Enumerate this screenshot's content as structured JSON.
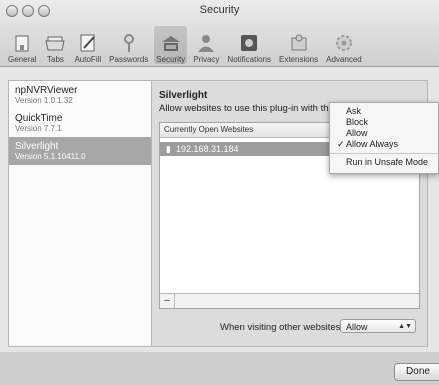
{
  "window": {
    "title": "Security"
  },
  "toolbar": {
    "items": [
      {
        "label": "General",
        "icon": "general-icon"
      },
      {
        "label": "Tabs",
        "icon": "tabs-icon"
      },
      {
        "label": "AutoFill",
        "icon": "autofill-icon"
      },
      {
        "label": "Passwords",
        "icon": "key-icon"
      },
      {
        "label": "Security",
        "icon": "lock-icon",
        "active": true
      },
      {
        "label": "Privacy",
        "icon": "person-icon"
      },
      {
        "label": "Notifications",
        "icon": "notifications-icon"
      },
      {
        "label": "Extensions",
        "icon": "puzzle-icon"
      },
      {
        "label": "Advanced",
        "icon": "gear-icon"
      }
    ]
  },
  "plugins": [
    {
      "name": "npNVRViewer",
      "version": "Version 1.0.1.32"
    },
    {
      "name": "QuickTime",
      "version": "Version 7.7.1"
    },
    {
      "name": "Silverlight",
      "version": "Version 5.1.10411.0",
      "selected": true
    }
  ],
  "main": {
    "title": "Silverlight",
    "description": "Allow websites to use this plug-in with th",
    "sites_header": "Currently Open Websites",
    "sites": [
      {
        "host": "192.168.31.184"
      }
    ],
    "minus_label": "–",
    "other_label": "When visiting other websites:",
    "other_value": "Allow",
    "other_arrows": "▲▼"
  },
  "menu": {
    "items": [
      {
        "label": "Ask",
        "checked": false
      },
      {
        "label": "Block",
        "checked": false
      },
      {
        "label": "Allow",
        "checked": false
      },
      {
        "label": "Allow Always",
        "checked": true
      }
    ],
    "checkmark": "✓",
    "extra": "Run in Unsafe Mode"
  },
  "footer": {
    "done_label": "Done"
  }
}
